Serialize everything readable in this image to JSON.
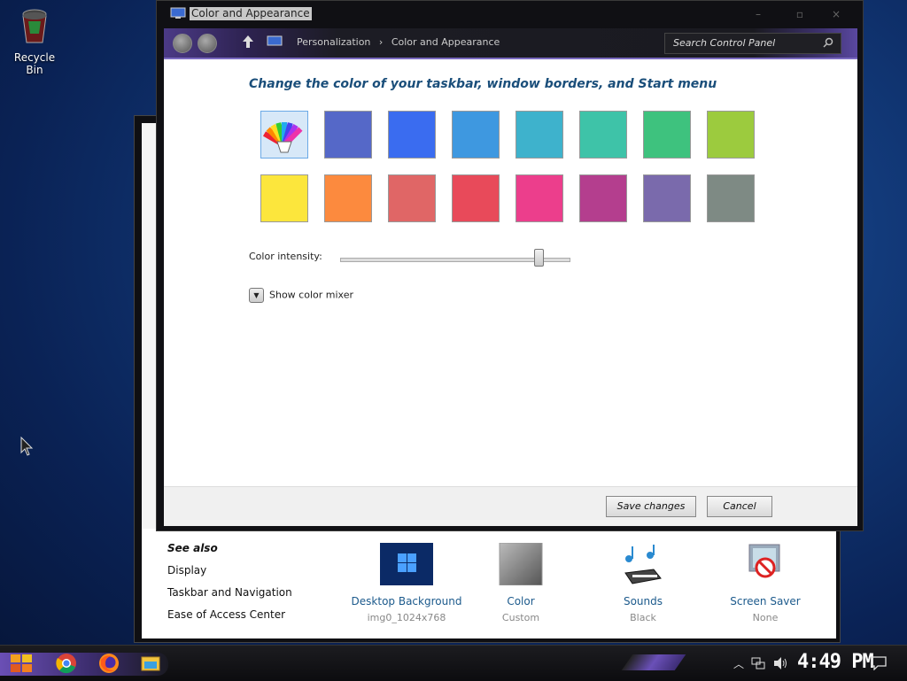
{
  "desktop": {
    "recycle_bin_label": "Recycle Bin"
  },
  "window": {
    "title": "Color and Appearance",
    "min": "–",
    "max": "▫",
    "close": "×"
  },
  "breadcrumb": [
    "Personalization",
    "Color and Appearance"
  ],
  "search": {
    "placeholder": "Search Control Panel"
  },
  "main": {
    "heading": "Change the color of your taskbar, window borders, and Start menu",
    "swatches_row1": [
      "custom",
      "#5568c8",
      "#3a6cf0",
      "#3e98e0",
      "#3eb2cc",
      "#3ec3a8",
      "#3ec27e",
      "#9ccb3e"
    ],
    "swatches_row2": [
      "#fce63c",
      "#fc8a3e",
      "#e06666",
      "#e84a5a",
      "#ec3e8c",
      "#b43e8e",
      "#7a6aac",
      "#7e8a84"
    ],
    "intensity_label": "Color intensity:",
    "intensity_value": 0.87,
    "mixer_label": "Show color mixer"
  },
  "footer": {
    "save": "Save changes",
    "cancel": "Cancel"
  },
  "back_window": {
    "see_also": [
      "See also",
      "Display",
      "Taskbar and Navigation",
      "Ease of Access Center"
    ],
    "tiles": [
      {
        "label": "Desktop Background",
        "sub": "img0_1024x768",
        "icon": "desktop-background-thumb"
      },
      {
        "label": "Color",
        "sub": "Custom",
        "icon": "color-thumb"
      },
      {
        "label": "Sounds",
        "sub": "Black",
        "icon": "sounds-icon"
      },
      {
        "label": "Screen Saver",
        "sub": "None",
        "icon": "screen-saver-icon"
      }
    ]
  },
  "taskbar": {
    "clock": "4:49 PM"
  }
}
